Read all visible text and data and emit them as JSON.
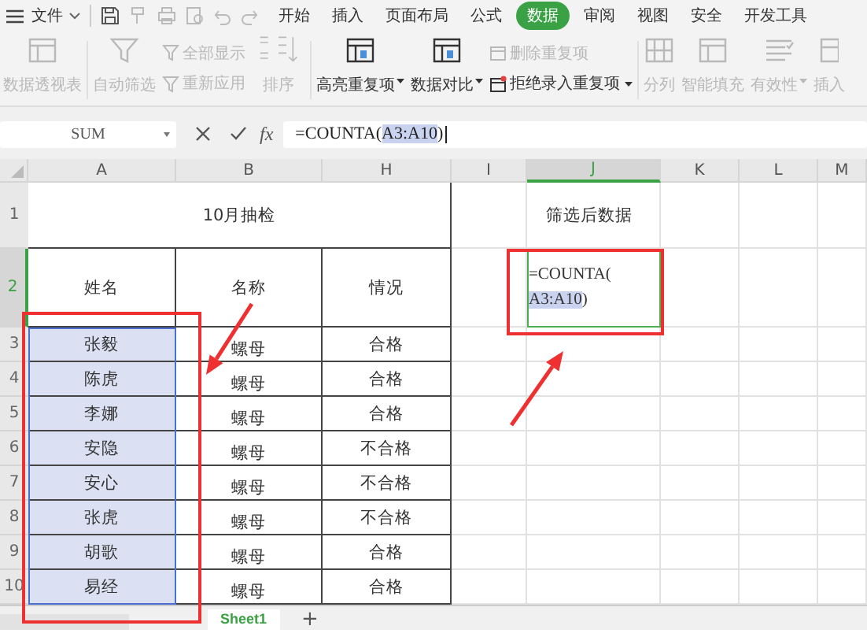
{
  "menu": {
    "file": "文件",
    "tabs": [
      {
        "label": "开始",
        "selected": false
      },
      {
        "label": "插入",
        "selected": false
      },
      {
        "label": "页面布局",
        "selected": false
      },
      {
        "label": "公式",
        "selected": false
      },
      {
        "label": "数据",
        "selected": true
      },
      {
        "label": "审阅",
        "selected": false
      },
      {
        "label": "视图",
        "selected": false
      },
      {
        "label": "安全",
        "selected": false
      },
      {
        "label": "开发工具",
        "selected": false
      }
    ]
  },
  "ribbon": [
    {
      "kind": "large",
      "label": "数据透视表",
      "disabled": true,
      "dropdown": false,
      "divider_after": true
    },
    {
      "kind": "large",
      "label": "自动筛选",
      "disabled": true,
      "dropdown": false,
      "divider_after": false
    },
    {
      "kind": "stack",
      "items": [
        {
          "label": "全部显示",
          "disabled": true,
          "dropdown": false
        },
        {
          "label": "重新应用",
          "disabled": true,
          "dropdown": false
        }
      ],
      "divider_after": false
    },
    {
      "kind": "sort",
      "label": "排序",
      "disabled": true,
      "dropdown": false,
      "divider_after": true
    },
    {
      "kind": "large",
      "label": "高亮重复项",
      "disabled": false,
      "dropdown": true,
      "divider_after": false
    },
    {
      "kind": "large",
      "label": "数据对比",
      "disabled": false,
      "dropdown": true,
      "divider_after": false
    },
    {
      "kind": "stack",
      "items": [
        {
          "label": "删除重复项",
          "disabled": true,
          "dropdown": false
        },
        {
          "label": "拒绝录入重复项",
          "disabled": false,
          "dropdown": true
        }
      ],
      "divider_after": true
    },
    {
      "kind": "large",
      "label": "分列",
      "disabled": true,
      "dropdown": false,
      "divider_after": false
    },
    {
      "kind": "large",
      "label": "智能填充",
      "disabled": true,
      "dropdown": false,
      "divider_after": false
    },
    {
      "kind": "large",
      "label": "有效性",
      "disabled": true,
      "dropdown": true,
      "divider_after": false
    },
    {
      "kind": "large",
      "label": "插入",
      "disabled": true,
      "dropdown": false,
      "divider_after": false
    }
  ],
  "formula_bar": {
    "name_box": "SUM",
    "function_label": "fx",
    "formula": [
      {
        "text": "=COUNTA(",
        "highlighted": false
      },
      {
        "text": "A3:A10",
        "highlighted": true
      },
      {
        "text": ")",
        "highlighted": false
      }
    ]
  },
  "columns": [
    {
      "label": "A",
      "selected": false
    },
    {
      "label": "B",
      "selected": false
    },
    {
      "label": "H",
      "selected": false
    },
    {
      "label": "I",
      "selected": false
    },
    {
      "label": "J",
      "selected": true
    },
    {
      "label": "K",
      "selected": false
    },
    {
      "label": "L",
      "selected": false
    },
    {
      "label": "M",
      "selected": false
    }
  ],
  "rows": [
    {
      "number": "1",
      "selected": false
    },
    {
      "number": "2",
      "selected": true
    },
    {
      "number": "3",
      "selected": false
    },
    {
      "number": "4",
      "selected": false
    },
    {
      "number": "5",
      "selected": false
    },
    {
      "number": "6",
      "selected": false
    },
    {
      "number": "7",
      "selected": false
    },
    {
      "number": "8",
      "selected": false
    },
    {
      "number": "9",
      "selected": false
    },
    {
      "number": "10",
      "selected": false
    }
  ],
  "sheet": {
    "title": "10月抽检",
    "side_title": "筛选后数据",
    "headers": [
      "姓名",
      "名称",
      "情况"
    ],
    "result_cell": {
      "active": true,
      "lines": [
        [
          {
            "text": "=COUNTA(",
            "highlighted": false
          }
        ],
        [
          {
            "text": "A3:A10",
            "highlighted": true
          },
          {
            "text": ")",
            "highlighted": false
          }
        ]
      ]
    },
    "records": [
      {
        "name": "张毅",
        "item": "螺母",
        "status": "合格",
        "selected": true
      },
      {
        "name": "陈虎",
        "item": "螺母",
        "status": "合格",
        "selected": true
      },
      {
        "name": "李娜",
        "item": "螺母",
        "status": "合格",
        "selected": true
      },
      {
        "name": "安隐",
        "item": "螺母",
        "status": "不合格",
        "selected": true
      },
      {
        "name": "安心",
        "item": "螺母",
        "status": "不合格",
        "selected": true
      },
      {
        "name": "张虎",
        "item": "螺母",
        "status": "不合格",
        "selected": true
      },
      {
        "name": "胡歌",
        "item": "螺母",
        "status": "合格",
        "selected": true
      },
      {
        "name": "易经",
        "item": "螺母",
        "status": "合格",
        "selected": true
      }
    ]
  },
  "sheet_tabs": [
    {
      "label": "Sheet1",
      "selected": true
    }
  ],
  "add_sheet": "+"
}
